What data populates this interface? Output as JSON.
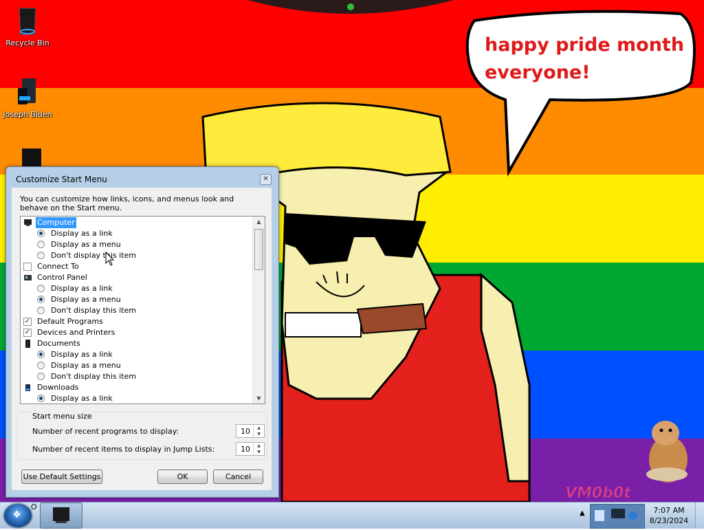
{
  "desktop": {
    "icons": [
      {
        "label": "Recycle Bin",
        "icon": "recycle-bin-icon"
      },
      {
        "label": "Joseph Biden",
        "icon": "computer-icon"
      }
    ],
    "wallpaper": {
      "speech_bubble_line1": "happy pride month",
      "speech_bubble_line2": "everyone!",
      "watermark": "VM0b0t",
      "colors": {
        "red": "#ff0000",
        "orange": "#ff8c00",
        "yellow": "#ffee00",
        "green": "#00a832",
        "blue": "#0050ff",
        "purple": "#7a1fa8",
        "speech_text": "#e01a1a"
      }
    }
  },
  "dialog": {
    "title": "Customize Start Menu",
    "description": "You can customize how links, icons, and menus look and behave on the Start menu.",
    "options": [
      {
        "type": "header",
        "label": "Computer",
        "selected": true,
        "icon": "computer-icon"
      },
      {
        "type": "radio",
        "label": "Display as a link",
        "checked": true
      },
      {
        "type": "radio",
        "label": "Display as a menu",
        "checked": false
      },
      {
        "type": "radio",
        "label": "Don't display this item",
        "checked": false
      },
      {
        "type": "checkbox",
        "label": "Connect To",
        "checked": false
      },
      {
        "type": "header",
        "label": "Control Panel",
        "icon": "control-panel-icon"
      },
      {
        "type": "radio",
        "label": "Display as a link",
        "checked": false
      },
      {
        "type": "radio",
        "label": "Display as a menu",
        "checked": true
      },
      {
        "type": "radio",
        "label": "Don't display this item",
        "checked": false
      },
      {
        "type": "checkbox",
        "label": "Default Programs",
        "checked": true
      },
      {
        "type": "checkbox",
        "label": "Devices and Printers",
        "checked": true
      },
      {
        "type": "header",
        "label": "Documents",
        "icon": "documents-icon"
      },
      {
        "type": "radio",
        "label": "Display as a link",
        "checked": true
      },
      {
        "type": "radio",
        "label": "Display as a menu",
        "checked": false
      },
      {
        "type": "radio",
        "label": "Don't display this item",
        "checked": false
      },
      {
        "type": "header",
        "label": "Downloads",
        "icon": "downloads-icon"
      },
      {
        "type": "radio",
        "label": "Display as a link",
        "checked": true
      }
    ],
    "start_menu_size": {
      "title": "Start menu size",
      "recent_programs_label": "Number of recent programs to display:",
      "recent_programs_value": "10",
      "recent_items_label": "Number of recent items to display in Jump Lists:",
      "recent_items_value": "10"
    },
    "buttons": {
      "defaults": "Use Default Settings",
      "ok": "OK",
      "cancel": "Cancel"
    }
  },
  "taskbar": {
    "start_label": "O",
    "time": "7:07 AM",
    "date": "8/23/2024"
  }
}
